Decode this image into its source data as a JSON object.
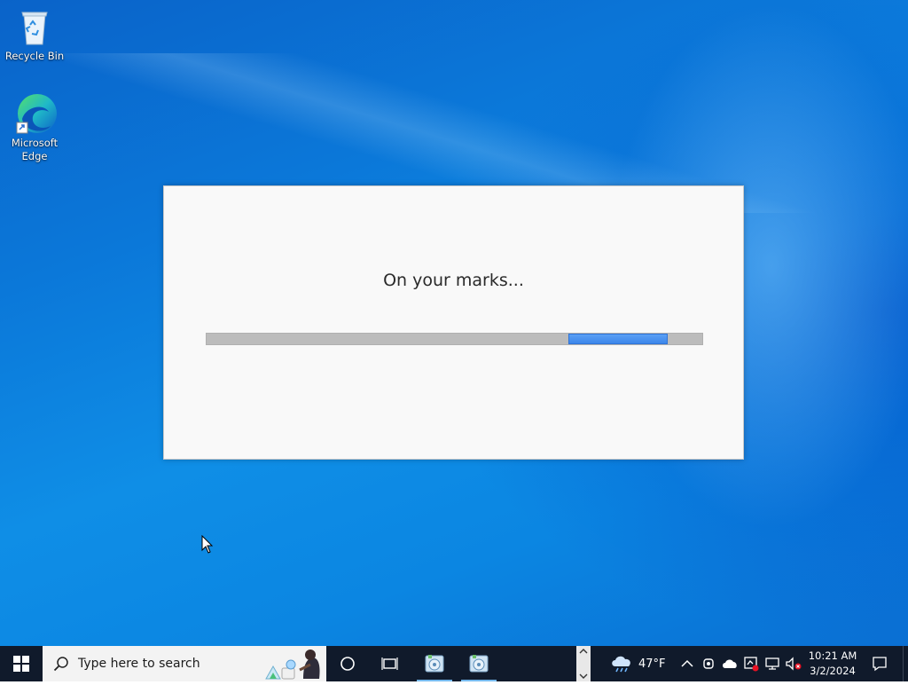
{
  "desktop": {
    "icons": [
      {
        "label": "Recycle Bin",
        "icon": "recycle-bin-icon"
      },
      {
        "label": "Microsoft Edge",
        "icon": "edge-icon"
      }
    ]
  },
  "dialog": {
    "message": "On your marks...",
    "progress": {
      "state": "indeterminate",
      "segment_start": 0.73,
      "segment_end": 0.93
    }
  },
  "taskbar": {
    "search_placeholder": "Type here to search",
    "weather": {
      "temperature": "47°F",
      "icon": "cloud-rain-icon"
    },
    "clock": {
      "time": "10:21 AM",
      "date": "3/2/2024"
    },
    "accent_color": "#76b9ed",
    "background_color": "#101a2b"
  }
}
